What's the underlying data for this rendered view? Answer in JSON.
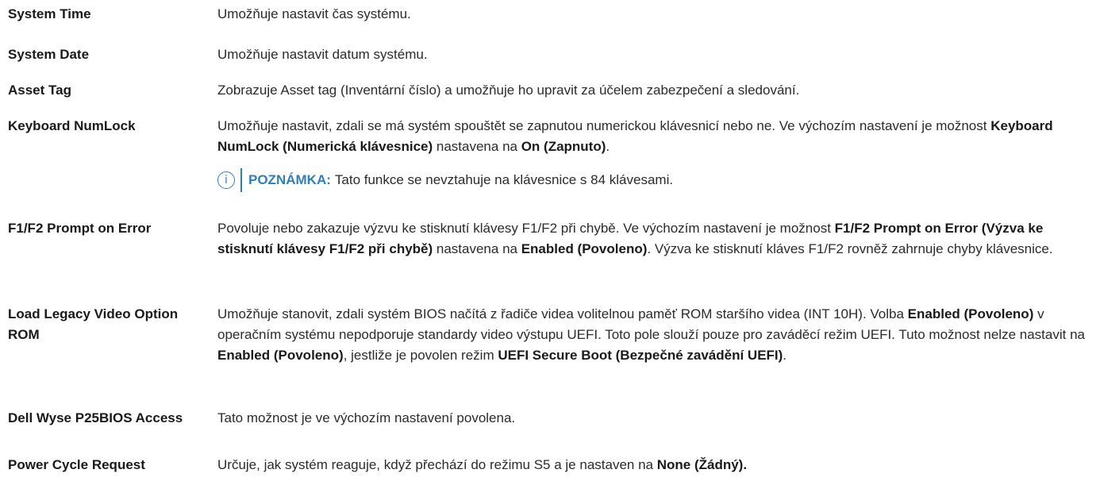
{
  "rows": [
    {
      "term": "System Time",
      "desc": "Umožňuje nastavit čas systému."
    },
    {
      "term": "System Date",
      "desc": "Umožňuje nastavit datum systému."
    },
    {
      "term": "Asset Tag",
      "desc": "Zobrazuje Asset tag (Inventární číslo) a umožňuje ho upravit za účelem zabezpečení a sledování."
    },
    {
      "term": "Keyboard NumLock",
      "desc": {
        "p1": "Umožňuje nastavit, zdali se má systém spouštět se zapnutou numerickou klávesnicí nebo ne. Ve výchozím nastavení je možnost ",
        "b1": "Keyboard NumLock (Numerická klávesnice)",
        "p2": " nastavena na ",
        "b2": "On (Zapnuto)",
        "p3": "."
      },
      "note": {
        "icon": "info-icon",
        "label": "POZNÁMKA:",
        "text": "Tato funkce se nevztahuje na klávesnice s 84 klávesami."
      }
    },
    {
      "term": "F1/F2 Prompt on Error",
      "desc": {
        "p1": "Povoluje nebo zakazuje výzvu ke stisknutí klávesy F1/F2 při chybě. Ve výchozím nastavení je možnost ",
        "b1": "F1/F2 Prompt on Error (Výzva ke stisknutí klávesy F1/F2 při chybě)",
        "p2": " nastavena na ",
        "b2": "Enabled (Povoleno)",
        "p3": ". Výzva ke stisknutí kláves F1/F2 rovněž zahrnuje chyby klávesnice."
      }
    },
    {
      "term": "Load Legacy Video Option ROM",
      "desc": {
        "p1": "Umožňuje stanovit, zdali systém BIOS načítá z řadiče videa volitelnou paměť ROM staršího videa (INT 10H). Volba ",
        "b1": "Enabled (Povoleno)",
        "p2": " v operačním systému nepodporuje standardy video výstupu UEFI. Toto pole slouží pouze pro zaváděcí režim UEFI. Tuto možnost nelze nastavit na ",
        "b2": "Enabled (Povoleno)",
        "p3": ", jestliže je povolen režim ",
        "b3": "UEFI Secure Boot (Bezpečné zavádění UEFI)",
        "p4": "."
      }
    },
    {
      "term": "Dell Wyse P25BIOS Access",
      "desc": "Tato možnost je ve výchozím nastavení povolena."
    },
    {
      "term": "Power Cycle Request",
      "desc": {
        "p1": "Určuje, jak systém reaguje, když přechází do režimu S5 a je nastaven na ",
        "b1": "None (Žádný)."
      }
    }
  ],
  "colors": {
    "accent": "#2c7fc4",
    "text": "#2b2b2b"
  }
}
